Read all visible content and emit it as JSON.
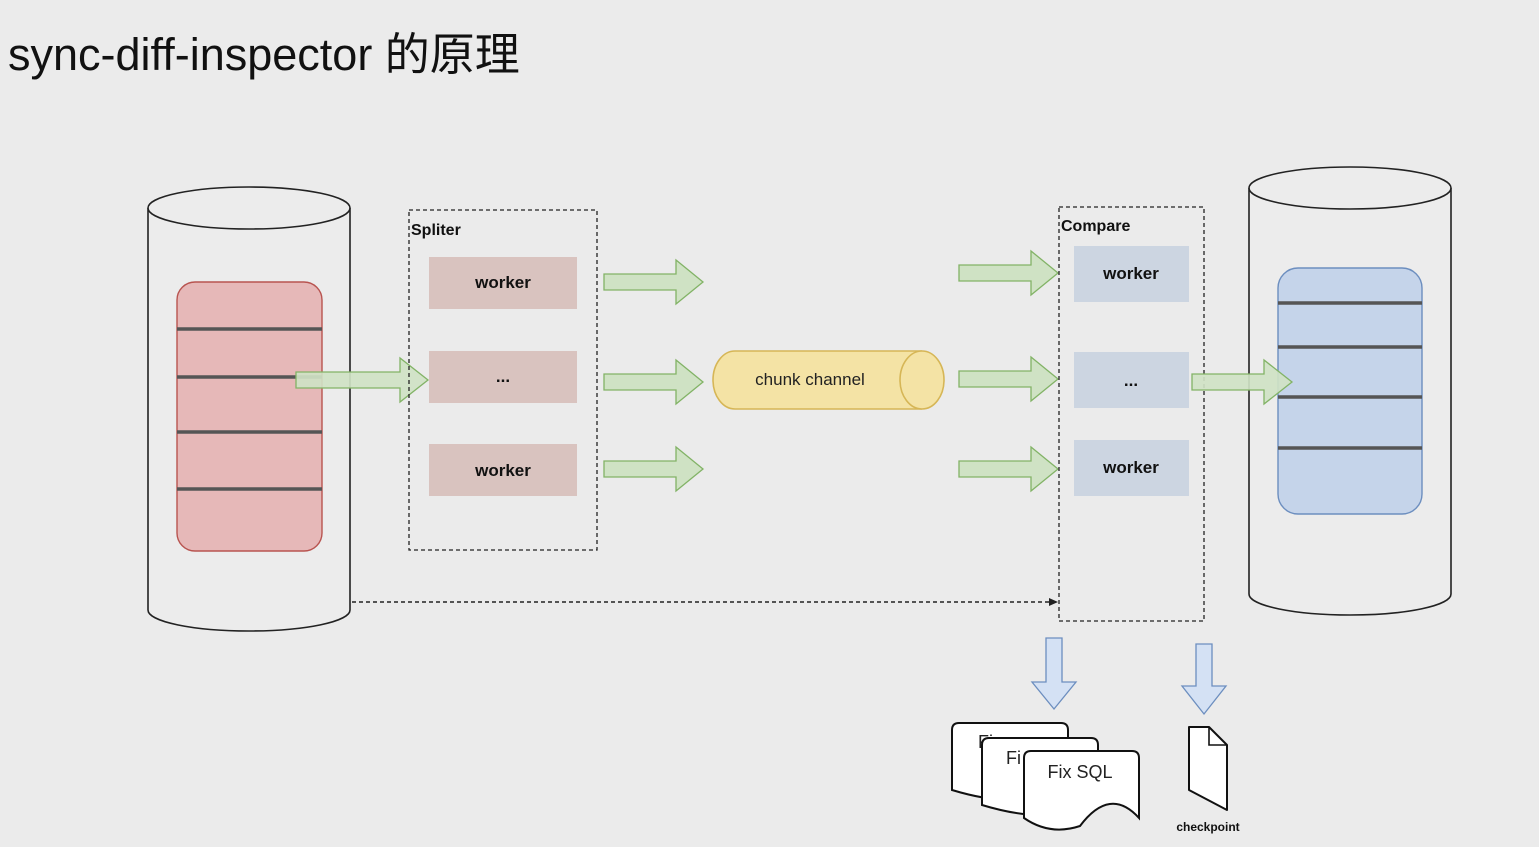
{
  "title": "sync-diff-inspector 的原理",
  "splitter": {
    "label": "Spliter",
    "workers": [
      "worker",
      "...",
      "worker"
    ]
  },
  "channel": {
    "label": "chunk channel"
  },
  "compare": {
    "label": "Compare",
    "workers": [
      "worker",
      "...",
      "worker"
    ]
  },
  "outputs": {
    "fix_sql_label": "Fix SQL",
    "fix_sql_partial_1": "Fi",
    "fix_sql_partial_2": "Fi",
    "checkpoint_label": "checkpoint"
  },
  "colors": {
    "background": "#ebebeb",
    "source_table_fill": "#e6b8b8",
    "source_table_stroke": "#b85450",
    "target_table_fill": "#c5d4ea",
    "target_table_stroke": "#6c8ebf",
    "splitter_worker_fill": "#d9c3bf",
    "compare_worker_fill": "#ccd5e1",
    "channel_fill": "#f4e3a5",
    "channel_stroke": "#d6b656",
    "flow_arrow_fill": "#cfe2c4",
    "flow_arrow_stroke": "#82b366",
    "output_arrow_fill": "#d4e1f4",
    "output_arrow_stroke": "#6c8ebf"
  }
}
